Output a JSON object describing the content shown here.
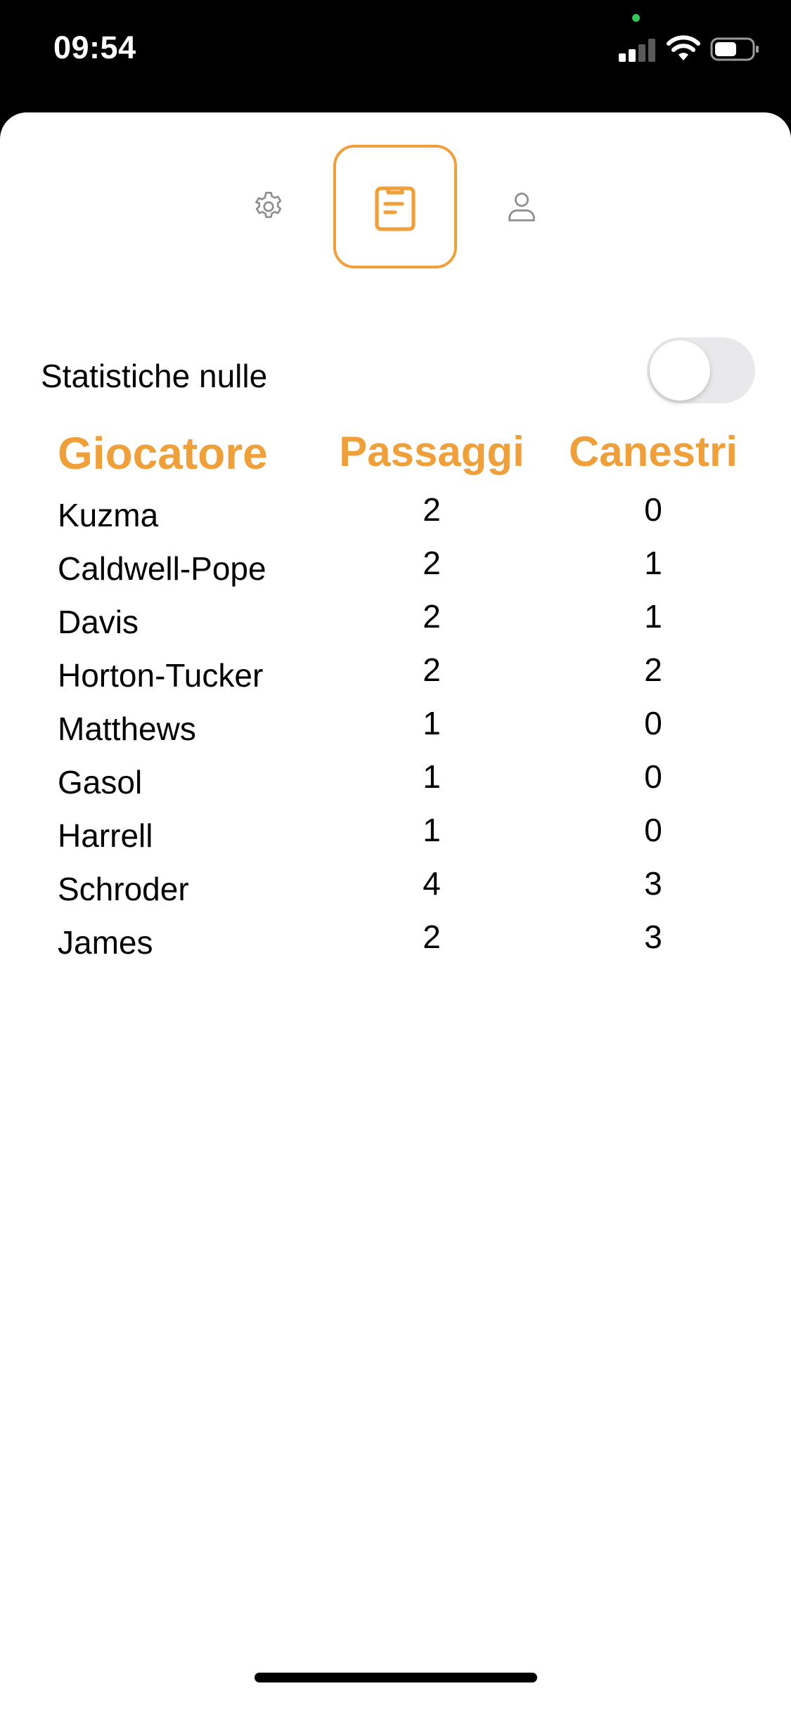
{
  "status_bar": {
    "time": "09:54"
  },
  "tabs": [
    {
      "name": "settings",
      "icon": "gear-icon"
    },
    {
      "name": "stats",
      "icon": "clipboard-icon",
      "selected": true
    },
    {
      "name": "profile",
      "icon": "person-icon"
    }
  ],
  "filter": {
    "label": "Statistiche nulle",
    "enabled": false
  },
  "table": {
    "headers": {
      "player": "Giocatore",
      "passes": "Passaggi",
      "baskets": "Canestri"
    },
    "rows": [
      {
        "player": "Kuzma",
        "passes": "2",
        "baskets": "0"
      },
      {
        "player": "Caldwell-Pope",
        "passes": "2",
        "baskets": "1"
      },
      {
        "player": "Davis",
        "passes": "2",
        "baskets": "1"
      },
      {
        "player": "Horton-Tucker",
        "passes": "2",
        "baskets": "2"
      },
      {
        "player": "Matthews",
        "passes": "1",
        "baskets": "0"
      },
      {
        "player": "Gasol",
        "passes": "1",
        "baskets": "0"
      },
      {
        "player": "Harrell",
        "passes": "1",
        "baskets": "0"
      },
      {
        "player": "Schroder",
        "passes": "4",
        "baskets": "3"
      },
      {
        "player": "James",
        "passes": "2",
        "baskets": "3"
      }
    ]
  },
  "colors": {
    "accent": "#f0a03a",
    "icon_gray": "#8e8e93"
  }
}
